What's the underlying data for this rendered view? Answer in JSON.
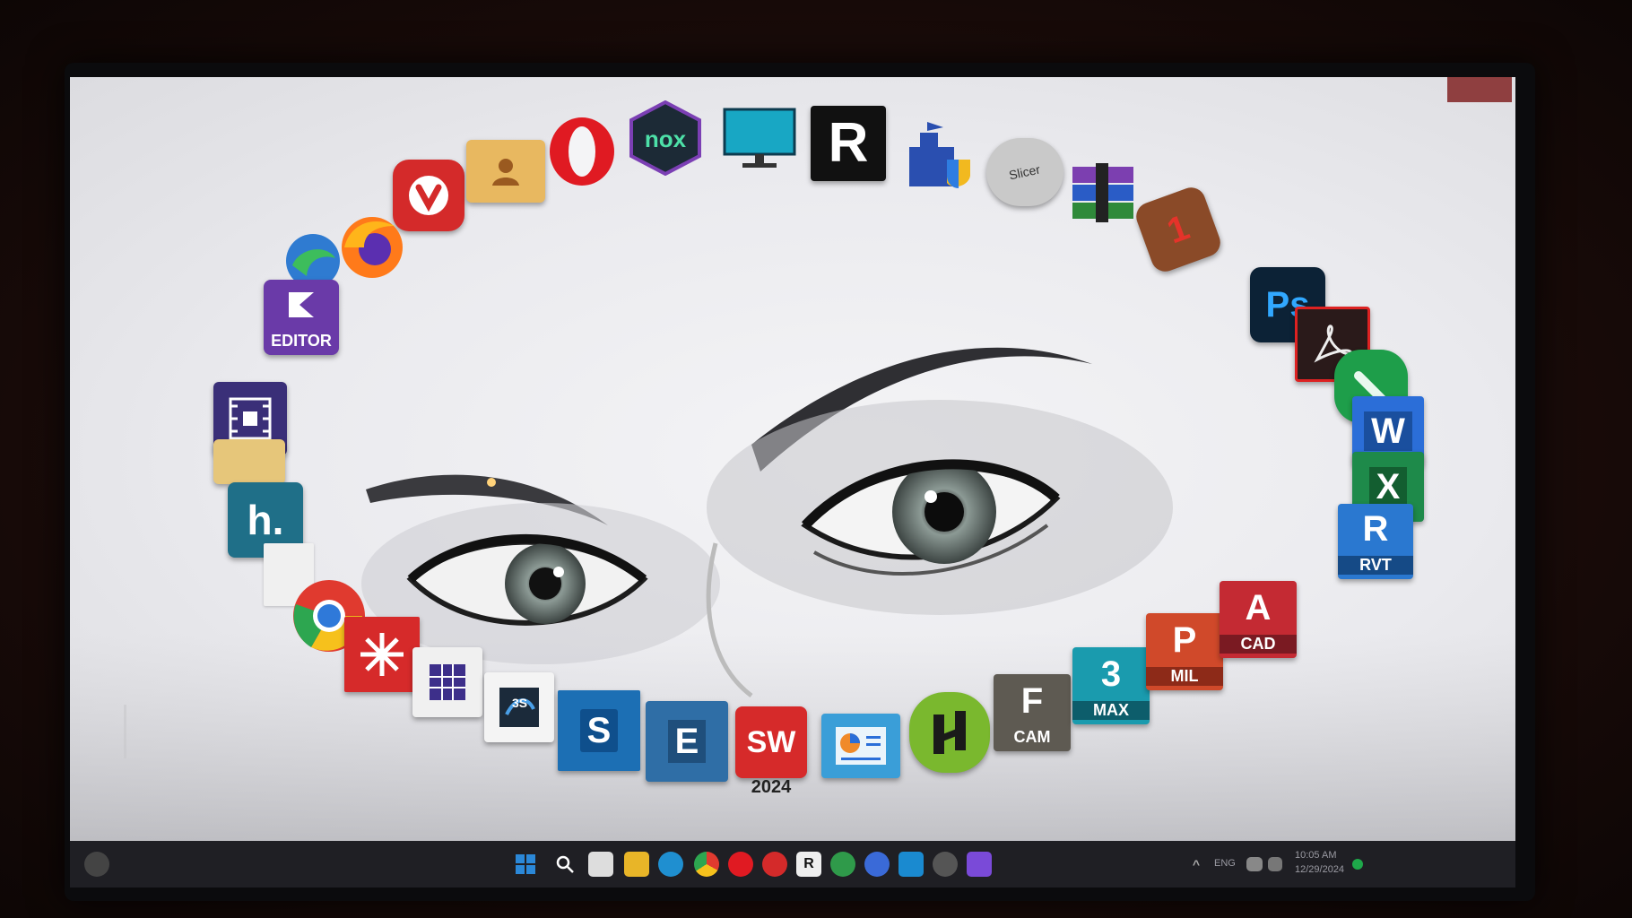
{
  "desktop": {
    "wallpaper": "black-and-white-eyes",
    "icons": [
      {
        "name": "foxit-editor",
        "text": "EDITOR"
      },
      {
        "name": "photoshop",
        "text": "Ps"
      },
      {
        "name": "word",
        "text": "W"
      },
      {
        "name": "excel",
        "text": "X"
      },
      {
        "name": "revit",
        "text": "R",
        "sub": "RVT"
      },
      {
        "name": "autocad",
        "text": "A",
        "sub": "CAD"
      },
      {
        "name": "autodesk-pmil",
        "text": "P",
        "sub": "MIL"
      },
      {
        "name": "3ds-max",
        "text": "3",
        "sub": "MAX"
      },
      {
        "name": "fusion-cam",
        "text": "F",
        "sub": "CAM"
      },
      {
        "name": "solidworks",
        "text": "SW",
        "sub": "2024"
      },
      {
        "name": "sharepoint",
        "text": "S"
      },
      {
        "name": "etabs",
        "text": "E"
      },
      {
        "name": "nox",
        "text": "nox"
      },
      {
        "name": "slicer",
        "text": "Slicer"
      },
      {
        "name": "hardware-info",
        "text": "h."
      },
      {
        "name": "rhino-r",
        "text": "R"
      }
    ]
  },
  "taskbar": {
    "tray": {
      "language": "ENG",
      "time": "10:05 AM",
      "date": "12/29/2024"
    }
  },
  "colors": {
    "taskbar": "#1f1f24",
    "accent": "#2b88d8"
  }
}
